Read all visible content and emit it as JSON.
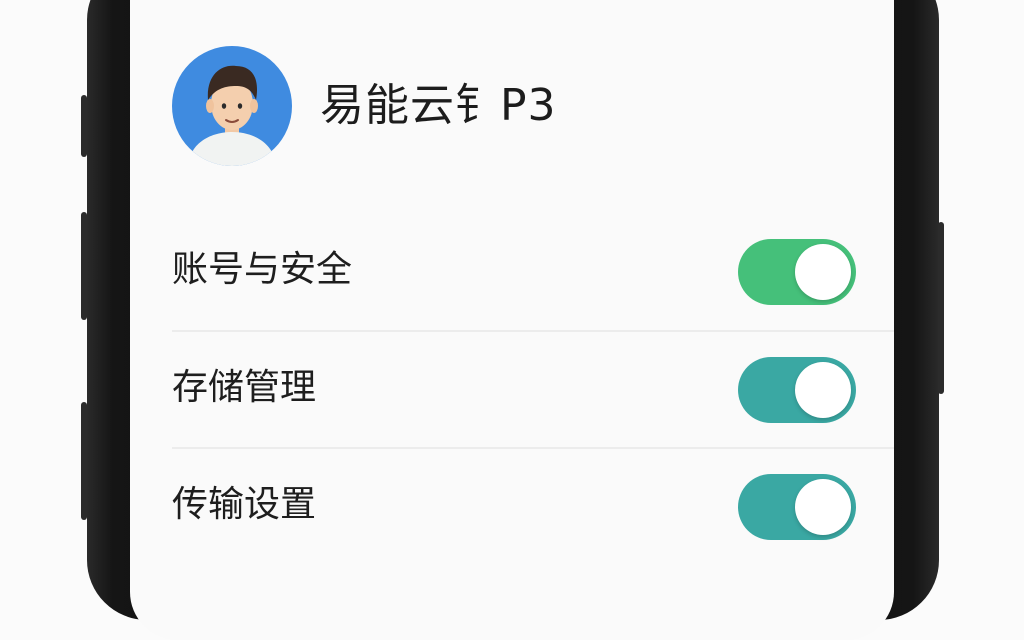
{
  "profile": {
    "name": "易能云钅P3",
    "avatar_bg": "#3f8be0"
  },
  "settings": [
    {
      "label": "账号与安全",
      "enabled": true,
      "color": "#45c07a"
    },
    {
      "label": "存储管理",
      "enabled": true,
      "color": "#3aa8a3"
    },
    {
      "label": "传输设置",
      "enabled": true,
      "color": "#3aa8a3"
    }
  ],
  "icons": {
    "back": "chevron-left-icon",
    "toggle": "toggle-switch-icon"
  }
}
